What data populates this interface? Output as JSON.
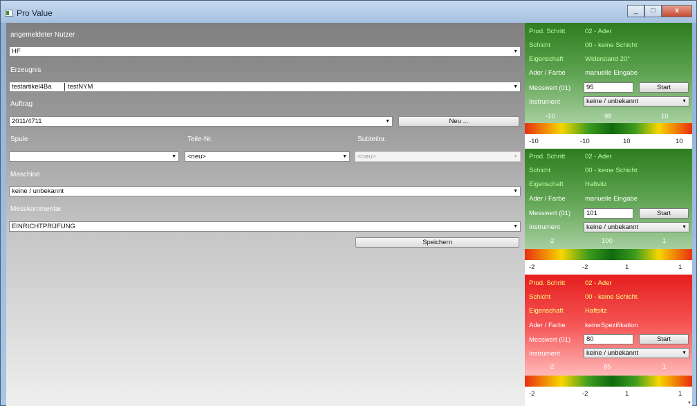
{
  "window": {
    "title": "Pro Value",
    "minimize": "_",
    "maximize": "□",
    "close": "x"
  },
  "form": {
    "user_label": "angemeldeter Nutzer",
    "user_value": "HF",
    "product_label": "Erzeugnis",
    "product_value1": "testartikel4Ba",
    "product_value2": "testNYM",
    "order_label": "Auftrag",
    "order_value": "2011/4711",
    "new_button": "Neu ...",
    "spool_label": "Spule",
    "spool_value": "",
    "part_label": "Teile-Nr.",
    "part_value": "<neu>",
    "subpart_label": "Subteilnr.",
    "subpart_value": "<neu>",
    "machine_label": "Maschine",
    "machine_value": "keine / unbekannt",
    "comment_label": "Messkommentar",
    "comment_value": "EINRICHTPRÜFUNG",
    "save_button": "Speichern"
  },
  "panel_labels": {
    "step": "Prod. Schritt",
    "layer": "Schicht",
    "property": "Eigenschaft",
    "wire": "Ader / Farbe",
    "measure": "Messwert (01)",
    "instrument": "Instrument",
    "start": "Start"
  },
  "panels": [
    {
      "status": "ok",
      "step": "02 - Ader",
      "layer": "00 - keine Schicht",
      "property": "Widerstand 20°",
      "wire": "manuelle Eingabe",
      "measure": "95",
      "instrument": "keine / unbekannt",
      "top_scale": [
        "-10",
        "98",
        "10"
      ],
      "bottom_scale": [
        "-10",
        "-10",
        "10",
        "10"
      ]
    },
    {
      "status": "ok",
      "step": "02 - Ader",
      "layer": "00 - keine Schicht",
      "property": "Haftsitz",
      "wire": "manuelle Eingabe",
      "measure": "101",
      "instrument": "keine / unbekannt",
      "top_scale": [
        "-2",
        "100",
        "1"
      ],
      "bottom_scale": [
        "-2",
        "-2",
        "1",
        "1"
      ]
    },
    {
      "status": "error",
      "step": "02 - Ader",
      "layer": "00 - keine Schicht",
      "property": "Haftsitz",
      "wire": "keineSpezifikation",
      "measure": "80",
      "instrument": "keine / unbekannt",
      "top_scale": [
        "-2",
        "85",
        "1"
      ],
      "bottom_scale": [
        "-2",
        "-2",
        "1",
        "1"
      ]
    }
  ],
  "icons": {
    "dropdown": "chevron-down-icon",
    "app": "app-icon"
  },
  "colors": {
    "ok_green": "#2e7d1f",
    "error_red": "#e61e1e",
    "highlight": "#b8ff9a"
  }
}
